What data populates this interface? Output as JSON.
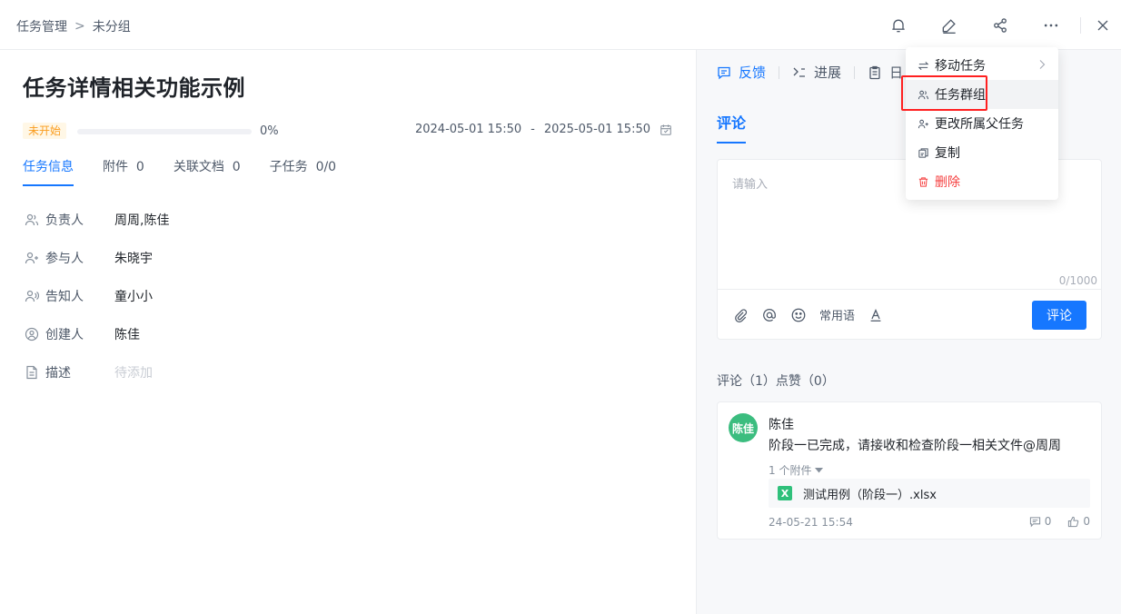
{
  "breadcrumb": {
    "root": "任务管理",
    "separator": ">",
    "current": "未分组"
  },
  "task": {
    "title": "任务详情相关功能示例",
    "status": "未开始",
    "progress": 0,
    "progress_text": "0%",
    "start": "2024-05-01 15:50",
    "date_sep": "-",
    "end": "2025-05-01 15:50"
  },
  "tabs": [
    {
      "label": "任务信息",
      "count": ""
    },
    {
      "label": "附件",
      "count": "0"
    },
    {
      "label": "关联文档",
      "count": "0"
    },
    {
      "label": "子任务",
      "count": "0/0"
    }
  ],
  "fields": [
    {
      "label": "负责人",
      "value": "周周,陈佳",
      "icon": "owner-icon"
    },
    {
      "label": "参与人",
      "value": "朱晓宇",
      "icon": "participant-icon"
    },
    {
      "label": "告知人",
      "value": "童小小",
      "icon": "notify-icon"
    },
    {
      "label": "创建人",
      "value": "陈佳",
      "icon": "creator-icon"
    },
    {
      "label": "描述",
      "value": "待添加",
      "icon": "document-icon"
    }
  ],
  "right_tabs": [
    {
      "label": "反馈",
      "icon": "feedback-icon"
    },
    {
      "label": "进展",
      "icon": "progress-icon"
    },
    {
      "label": "日",
      "icon": "log-icon"
    }
  ],
  "comment": {
    "section_title": "评论",
    "placeholder": "请输入",
    "counter": "0/1000",
    "phrases": "常用语",
    "submit": "评论",
    "stats": "评论（1）点赞（0）"
  },
  "comments": [
    {
      "avatar": "陈佳",
      "author": "陈佳",
      "text": "阶段一已完成，请接收和检查阶段一相关文件@周周",
      "attach_toggle": "1 个附件",
      "file": "测试用例（阶段一）.xlsx",
      "file_badge": "X",
      "time": "24-05-21 15:54",
      "replies": "0",
      "likes": "0"
    }
  ],
  "menu": [
    {
      "label": "移动任务",
      "icon": "move-icon",
      "submenu": true
    },
    {
      "label": "任务群组",
      "icon": "group-icon",
      "hover": true
    },
    {
      "label": "更改所属父任务",
      "icon": "parent-task-icon"
    },
    {
      "label": "复制",
      "icon": "copy-icon"
    },
    {
      "label": "删除",
      "icon": "trash-icon",
      "danger": true
    }
  ],
  "colors": {
    "primary": "#1677ff",
    "danger": "#f53f3f",
    "status_bg": "#fff7e6",
    "status_text": "#fa9c1e",
    "avatar": "#3bbd7f",
    "highlight": "#ff2020"
  }
}
